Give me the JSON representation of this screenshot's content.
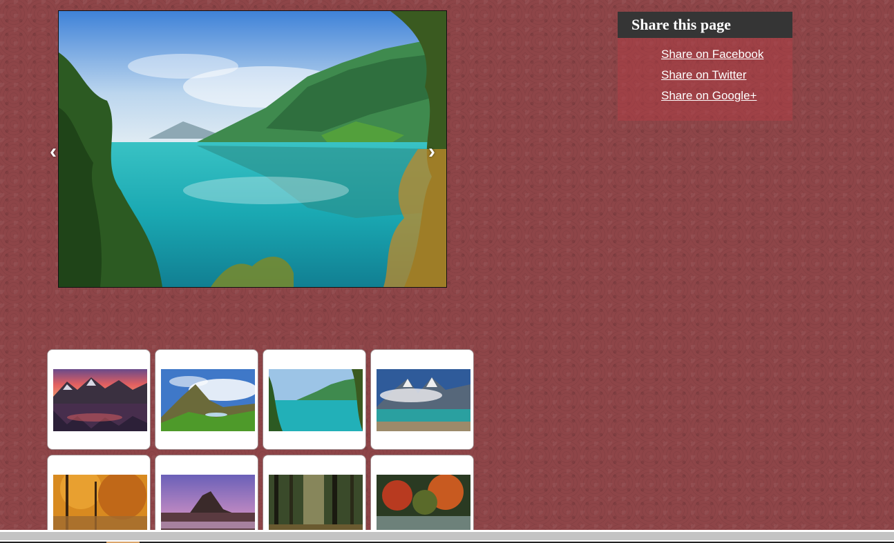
{
  "slider": {
    "prev_arrow": "‹",
    "next_arrow": "›",
    "current_slide": "lake-valley"
  },
  "share": {
    "title": "Share this page",
    "links": [
      {
        "label": "Share on Facebook"
      },
      {
        "label": "Share on Twitter"
      },
      {
        "label": "Share on Google+"
      }
    ]
  },
  "thumbnails": [
    {
      "scene": "sunset-mountain-lake"
    },
    {
      "scene": "green-mountain-valley"
    },
    {
      "scene": "turquoise-lake"
    },
    {
      "scene": "snowy-peaks-lake"
    },
    {
      "scene": "autumn-forest-river"
    },
    {
      "scene": "pink-sky-mountain"
    },
    {
      "scene": "dark-forest"
    },
    {
      "scene": "autumn-garden"
    }
  ],
  "colors": {
    "background": "#8e4548",
    "share_header": "#353535",
    "share_panel": "#a34a50",
    "thumb_border": "#9a8587"
  }
}
